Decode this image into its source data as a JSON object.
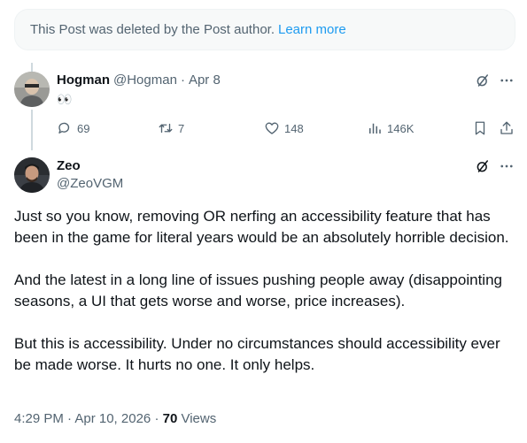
{
  "deleted_notice": {
    "text": "This Post was deleted by the Post author.",
    "link": "Learn more"
  },
  "reply": {
    "display_name": "Hogman",
    "handle": "@Hogman",
    "separator": "·",
    "date": "Apr 8",
    "text": "👀",
    "actions": {
      "replies": "69",
      "reposts": "7",
      "likes": "148",
      "views": "146K"
    }
  },
  "main_post": {
    "display_name": "Zeo",
    "handle": "@ZeoVGM",
    "paragraphs": [
      "Just so you know, removing OR nerfing an accessibility feature that has been in the game for literal years would be an absolutely horrible decision.",
      "And the latest in a long line of issues pushing people away (disappointing seasons, a UI that gets worse and worse, price increases).",
      "But this is accessibility. Under no circumstances should accessibility ever be made worse. It hurts no one. It only helps."
    ],
    "timestamp": "4:29 PM · Apr 10, 2026",
    "separator": "·",
    "view_count": "70",
    "views_label": "Views"
  },
  "icons": {
    "grok": "grok-icon",
    "more": "more-icon",
    "reply": "reply-icon",
    "repost": "repost-icon",
    "like": "heart-icon",
    "views": "analytics-icon",
    "bookmark": "bookmark-icon",
    "share": "share-icon"
  },
  "colors": {
    "accent": "#1d9bf0",
    "secondary_text": "#536471",
    "primary_text": "#0f1419",
    "notice_bg": "#f7f9f9"
  }
}
